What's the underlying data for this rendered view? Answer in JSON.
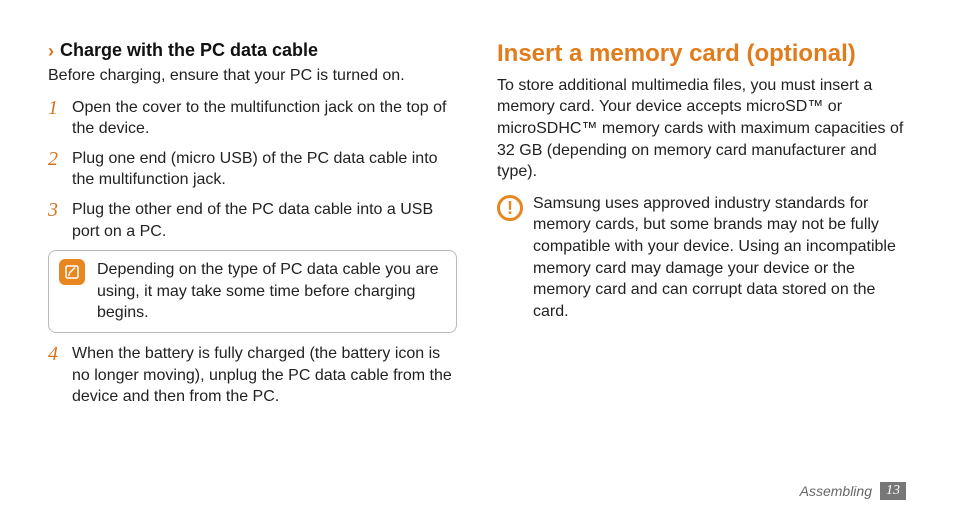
{
  "left": {
    "subheading": "Charge with the PC data cable",
    "intro": "Before charging, ensure that your PC is turned on.",
    "steps": [
      {
        "num": "1",
        "text": "Open the cover to the multifunction jack on the top of the device."
      },
      {
        "num": "2",
        "text": "Plug one end (micro USB) of the PC data cable into the multifunction jack."
      },
      {
        "num": "3",
        "text": "Plug the other end of the PC data cable into a USB port on a PC."
      }
    ],
    "note": "Depending on the type of PC data cable you are using, it may take some time before charging begins.",
    "step4": {
      "num": "4",
      "text": "When the battery is fully charged (the battery icon is no longer moving), unplug the PC data cable from the device and then from the PC."
    }
  },
  "right": {
    "heading": "Insert a memory card (optional)",
    "intro": "To store additional multimedia files, you must insert a memory card. Your device accepts microSD™ or microSDHC™ memory cards with maximum capacities of 32 GB (depending on memory card manufacturer and type).",
    "warning": "Samsung uses approved industry standards for memory cards, but some brands may not be fully compatible with your device. Using an incompatible memory card may damage your device or the memory card and can corrupt data stored on the card."
  },
  "footer": {
    "section": "Assembling",
    "page": "13"
  }
}
